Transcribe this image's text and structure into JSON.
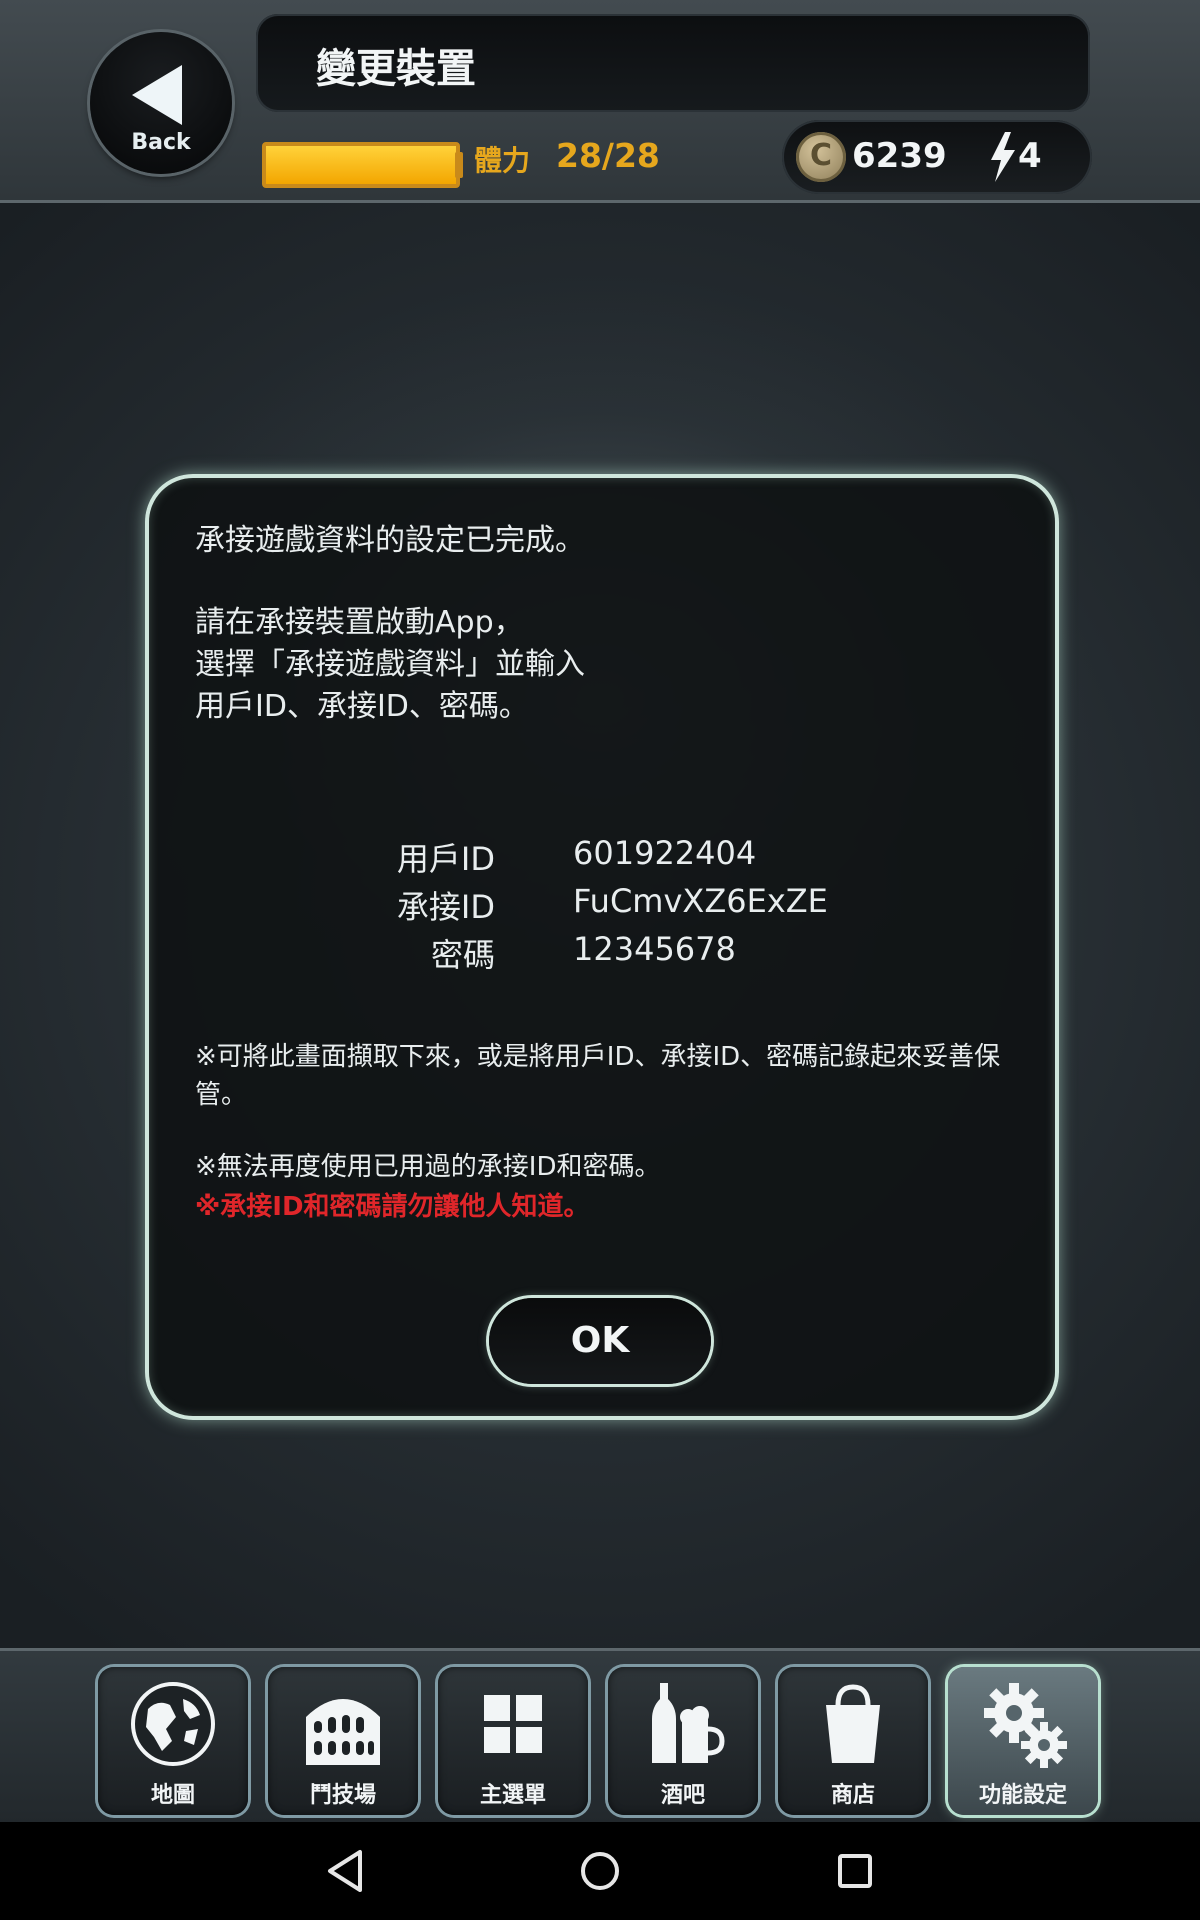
{
  "header": {
    "back_label": "Back",
    "title": "變更裝置",
    "stamina_label": "體力",
    "stamina_value": "28/28",
    "stamina_fraction": 1.0,
    "coins": "6239",
    "energy": "4"
  },
  "dialog": {
    "line1": "承接遊戲資料的設定已完成。",
    "instructions": "請在承接裝置啟動App，\n選擇「承接遊戲資料」並輸入\n用戶ID、承接ID、密碼。",
    "rows": [
      {
        "label": "用戶ID",
        "value": "601922404"
      },
      {
        "label": "承接ID",
        "value": "FuCmvXZ6ExZE"
      },
      {
        "label": "密碼",
        "value": "12345678"
      }
    ],
    "note1": "※可將此畫面擷取下來，或是將用戶ID、承接ID、密碼記錄起來妥善保管。",
    "note2": "※無法再度使用已用過的承接ID和密碼。",
    "note3": "※承接ID和密碼請勿讓他人知道。",
    "ok_label": "OK"
  },
  "nav": {
    "items": [
      {
        "label": "地圖",
        "icon": "globe-icon"
      },
      {
        "label": "鬥技場",
        "icon": "colosseum-icon"
      },
      {
        "label": "主選單",
        "icon": "grid-icon"
      },
      {
        "label": "酒吧",
        "icon": "drinks-icon"
      },
      {
        "label": "商店",
        "icon": "shopping-bag-icon"
      },
      {
        "label": "功能設定",
        "icon": "gear-icon",
        "active": true
      }
    ]
  },
  "colors": {
    "accent_glow": "#cfe6dc",
    "stamina": "#e6a71d",
    "warning": "#e0262a"
  }
}
